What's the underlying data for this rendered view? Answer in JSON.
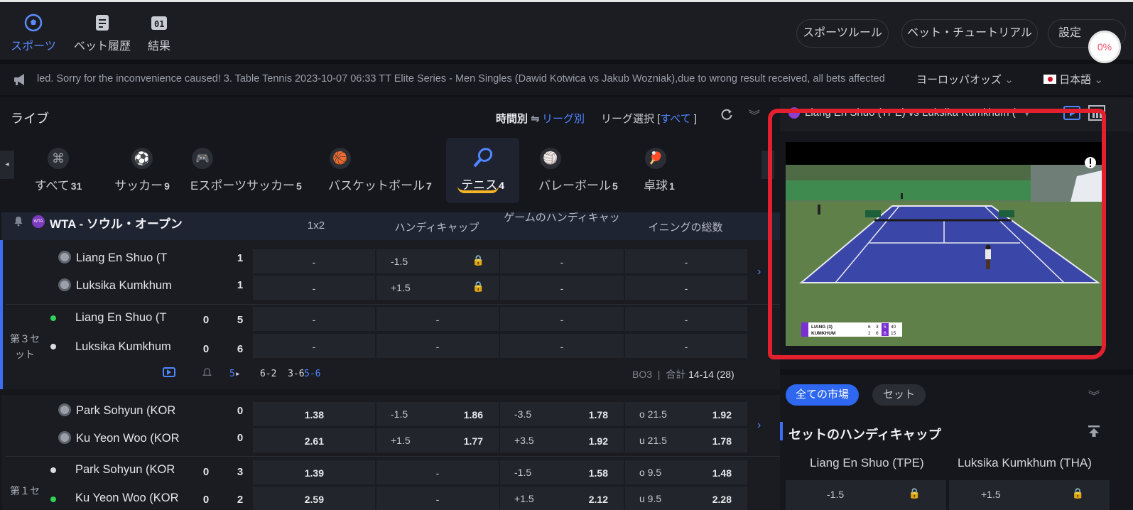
{
  "nav": {
    "items": [
      {
        "label": "スポーツ",
        "icon": "soccer-ball-icon"
      },
      {
        "label": "ベット履歴",
        "icon": "document-icon"
      },
      {
        "label": "結果",
        "icon": "scoreboard-icon"
      }
    ],
    "rule_btn": "スポーツルール",
    "tutorial_btn": "ベット・チュートリアル",
    "settings_btn": "設定",
    "badge": "0%"
  },
  "ticker": {
    "message": "led. Sorry for the inconvenience caused!  3. Table Tennis 2023-10-07 06:33 TT Elite Series - Men Singles (Dawid Kotwica vs Jakub Wozniak),due to wrong result received, all bets affected",
    "odds_format": "ヨーロッパオッズ",
    "language": "日本語"
  },
  "live": {
    "title": "ライブ",
    "sort_time": "時間別",
    "sort_league": "リーグ別",
    "league_select": "リーグ選択 [",
    "league_select_value": "すべて",
    "league_select_end": " ]"
  },
  "sports": [
    {
      "label": "すべて",
      "count": "31"
    },
    {
      "label": "サッカー",
      "count": "9"
    },
    {
      "label": "Eスポーツサッカー",
      "count": "5"
    },
    {
      "label": "バスケットボール",
      "count": "7"
    },
    {
      "label": "テニス",
      "count": "4"
    },
    {
      "label": "バレーボール",
      "count": "5"
    },
    {
      "label": "卓球",
      "count": "1"
    }
  ],
  "league": {
    "name": "WTA - ソウル・オープン",
    "columns": [
      "1x2",
      "ハンディキャップ",
      "ゲームのハンディキャップ",
      "イニングの総数"
    ]
  },
  "match1": {
    "pre": {
      "team1": "Liang En Shuo (T",
      "team2": "Luksika Kumkhum",
      "n1": "1",
      "n2": "1",
      "hcp1": "-1.5",
      "hcp2": "+1.5"
    },
    "live": {
      "set_label": "第３セット",
      "team1": "Liang En Shuo (T",
      "team2": "Luksika Kumkhum",
      "s1a": "0",
      "s1b": "5",
      "s2a": "0",
      "s2b": "6"
    },
    "footer": {
      "count": "5",
      "sets": "6-2  3-6",
      "current": "5-6",
      "bo": "BO3",
      "sep": "|",
      "total_lbl": "合計",
      "total": "14-14 (28)"
    },
    "dash": "-"
  },
  "match2": {
    "pre": {
      "team1": "Park Sohyun (KOR",
      "team2": "Ku Yeon Woo (KOR",
      "n1": "0",
      "n2": "0",
      "o1": "1.38",
      "o2": "2.61",
      "h1l": "-1.5",
      "h1r": "1.86",
      "h2l": "+1.5",
      "h2r": "1.77",
      "g1l": "-3.5",
      "g1r": "1.78",
      "g2l": "+3.5",
      "g2r": "1.92",
      "t1l": "o 21.5",
      "t1r": "1.92",
      "t2l": "u 21.5",
      "t2r": "1.78"
    },
    "live": {
      "set_label": "第１セ",
      "team1": "Park Sohyun (KOR",
      "team2": "Ku Yeon Woo (KOR",
      "s1a": "0",
      "s1b": "3",
      "s2a": "0",
      "s2b": "2",
      "o1": "1.39",
      "o2": "2.59",
      "g1l": "-1.5",
      "g1r": "1.58",
      "g2l": "+1.5",
      "g2r": "2.12",
      "t1l": "o 9.5",
      "t1r": "1.48",
      "t2l": "u 9.5",
      "t2r": "2.28"
    }
  },
  "right": {
    "match_title": "Liang En Shuo (TPE) vs Luksika Kumkhum (",
    "scoreboard": {
      "p1": "LIANG (3)",
      "p1s": [
        "6",
        "3",
        "5",
        "40"
      ],
      "p2": "KUMKHUM",
      "p2s": [
        "2",
        "6",
        "6",
        "15"
      ]
    },
    "chip_all": "全ての市場",
    "chip_set": "セット",
    "panel_title": "セットのハンディキャップ",
    "team1": "Liang En Shuo (TPE)",
    "team2": "Luksika Kumkhum (THA)",
    "hcp1": "-1.5",
    "hcp2": "+1.5"
  },
  "colors": {
    "accent": "#3b6ef5",
    "annotation": "#e5202e",
    "tennis_court": "#3b47a8"
  }
}
